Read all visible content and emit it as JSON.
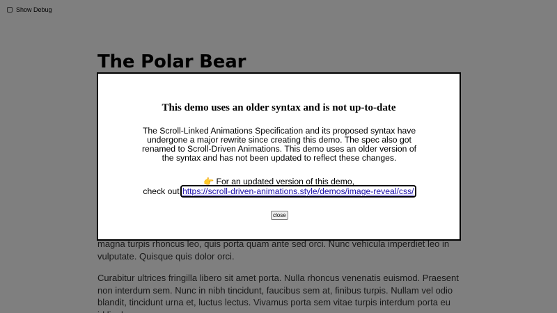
{
  "debug": {
    "label": "Show Debug",
    "checked": false
  },
  "article": {
    "title": "The Polar Bear",
    "paragraphs": [
      "magna turpis rhoncus leo, quis porta quam ante sed orci. Nunc vehicula imperdiet leo in vulputate. Quisque quis dolor orci.",
      "Curabitur ultrices fringilla libero sit amet porta. Nulla rhoncus venenatis euismod. Praesent non interdum sem. Nunc in nibh tincidunt, faucibus sem at, finibus turpis. Nullam vel odio blandit, tincidunt urna et, luctus lectus. Vivamus porta sem vitae turpis interdum porta eu id ligula."
    ]
  },
  "dialog": {
    "title": "This demo uses an older syntax and is not up-to-date",
    "body": "The Scroll-Linked Animations Specification and its proposed syntax have undergone a major rewrite since creating this demo. The spec also got renamed to Scroll-Driven Animations. This demo uses an older version of the syntax and has not been updated to reflect these changes.",
    "update_icon": "👉",
    "update_line1": "For an updated version of this demo,",
    "update_line2_prefix": "check out",
    "link_text": "https://scroll-driven-animations.style/demos/image-reveal/css/",
    "close_label": "close"
  },
  "colors": {
    "backdrop": "rgba(0,0,0,0.5)",
    "link": "#1a0dab"
  }
}
